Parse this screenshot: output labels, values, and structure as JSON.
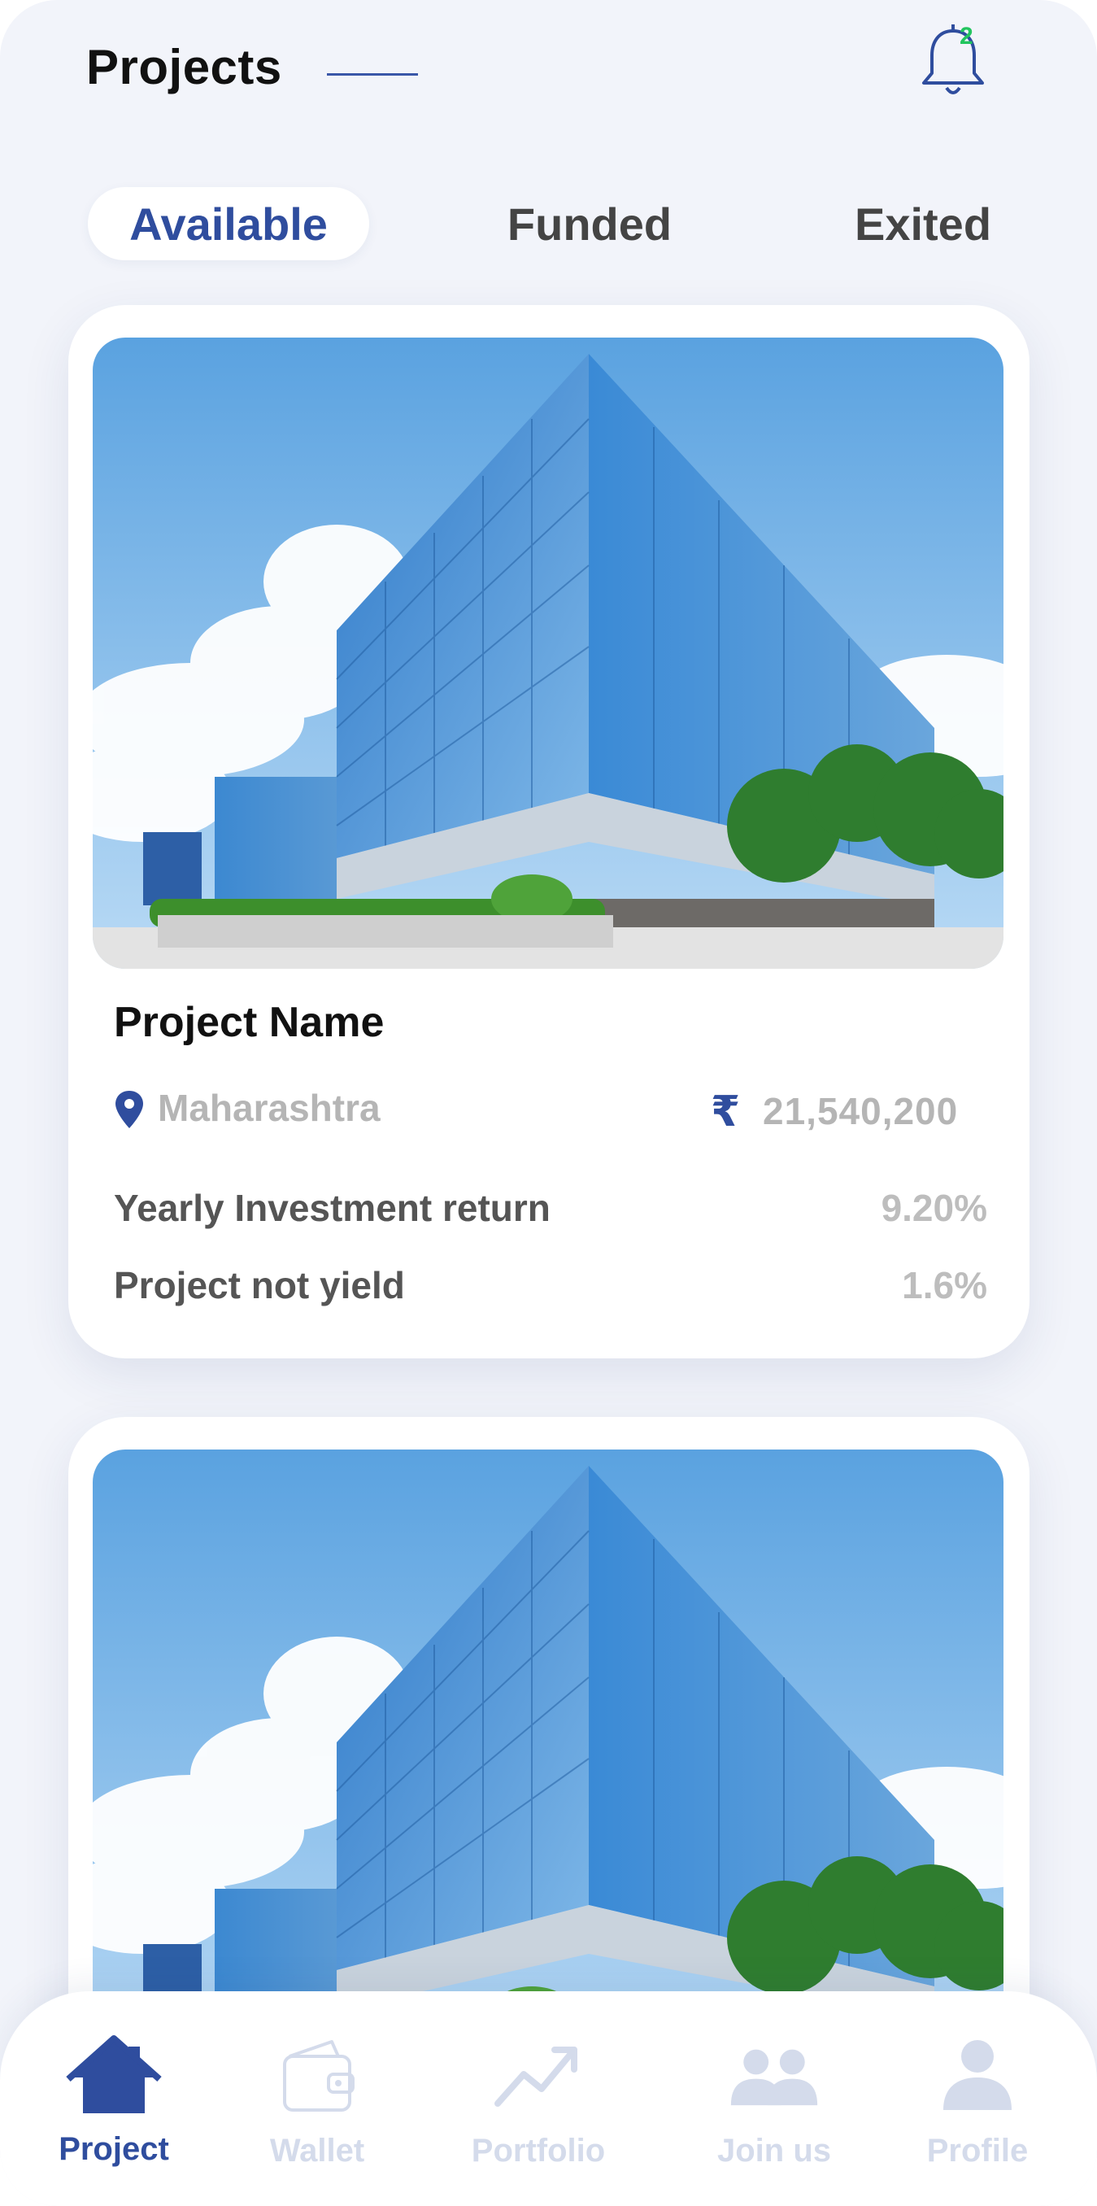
{
  "header": {
    "title": "Projects",
    "notification_count": "2"
  },
  "tabs": [
    {
      "label": "Available",
      "active": true
    },
    {
      "label": "Funded",
      "active": false
    },
    {
      "label": "Exited",
      "active": false
    }
  ],
  "projects": [
    {
      "name": "Project Name",
      "location": "Maharashtra",
      "currency_symbol": "₹",
      "amount": "21,540,200",
      "metrics": [
        {
          "label": "Yearly Investment return",
          "value": "9.20%"
        },
        {
          "label": "Project  not yield",
          "value": "1.6%"
        }
      ]
    },
    {
      "image": "office-building-photo"
    }
  ],
  "bottom_nav": [
    {
      "label": "Project",
      "icon": "home-icon",
      "active": true
    },
    {
      "label": "Wallet",
      "icon": "wallet-icon",
      "active": false
    },
    {
      "label": "Portfolio",
      "icon": "trending-up-icon",
      "active": false
    },
    {
      "label": "Join us",
      "icon": "users-icon",
      "active": false
    },
    {
      "label": "Profile",
      "icon": "user-icon",
      "active": false
    }
  ],
  "colors": {
    "accent": "#2f4d9e",
    "inactive": "#d4dbeb",
    "badge": "#22c55e",
    "background": "#f2f4fa"
  }
}
